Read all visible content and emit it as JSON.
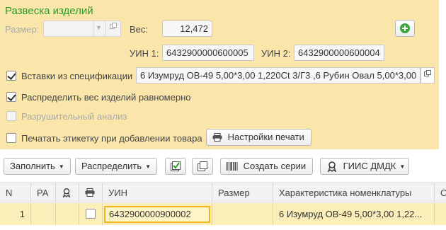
{
  "header": {
    "title": "Развеска изделий"
  },
  "form": {
    "size_label": "Размер:",
    "size_value": "",
    "weight_label": "Вес:",
    "weight_value": "12,472",
    "uin1_label": "УИН 1:",
    "uin1_value": "6432900000600005",
    "uin2_label": "УИН 2:",
    "uin2_value": "6432900000600004",
    "inserts_label": "Вставки из спецификации",
    "inserts_value": "6 Изумруд ОВ-49 5,00*3,00 1,220Ct 3/Г3 ,6 Рубин Овал 5,00*3,00",
    "distribute_weight_label": "Распределить вес изделий равномерно",
    "destructive_label": "Разрушительный анализ",
    "print_label_label": "Печатать этикетку при добавлении товара",
    "print_settings_label": "Настройки печати"
  },
  "checkboxes": {
    "inserts": true,
    "distribute_weight": true,
    "destructive": false,
    "print_label": false
  },
  "toolbar": {
    "fill_label": "Заполнить",
    "distribute_label": "Распределить",
    "create_series_label": "Создать серии",
    "giis_label": "ГИИС ДМДК"
  },
  "table": {
    "columns": [
      "N",
      "РА",
      "",
      "",
      "УИН",
      "Размер",
      "Характеристика номенклатуры",
      "С"
    ],
    "rows": [
      {
        "n": "1",
        "ra": "",
        "uin": "6432900000900002",
        "size": "",
        "characteristic": "6 Изумруд ОВ-49 5,00*3,00 1,22..."
      }
    ]
  },
  "colors": {
    "panel_bg": "#fae6ab",
    "title_green": "#2a9a2a",
    "row_selected": "#fbeeb8",
    "focus_border": "#f2b51f"
  }
}
